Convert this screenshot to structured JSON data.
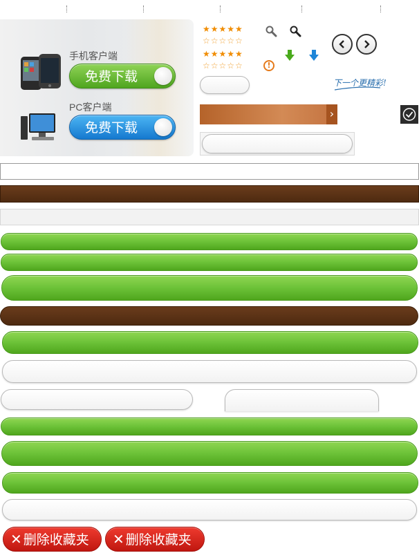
{
  "download_panel": {
    "mobile_label": "手机客户端",
    "mobile_button": "免费下载",
    "pc_label": "PC客户端",
    "pc_button": "免费下载"
  },
  "widgets": {
    "stars": {
      "filled": "★★★★★",
      "empty": "☆☆☆☆☆"
    },
    "warning_glyph": "!",
    "handwritten_next": "下一个更精彩!",
    "slider_arrow": "›"
  },
  "actions": {
    "delete_favorites_1": "删除收藏夹",
    "delete_favorites_2": "删除收藏夹",
    "close_glyph": "✕"
  },
  "colors": {
    "green": "#6cc238",
    "brown": "#5a3214",
    "blue": "#1f86d8",
    "red": "#d8261c",
    "orange_star": "#f08c00"
  }
}
